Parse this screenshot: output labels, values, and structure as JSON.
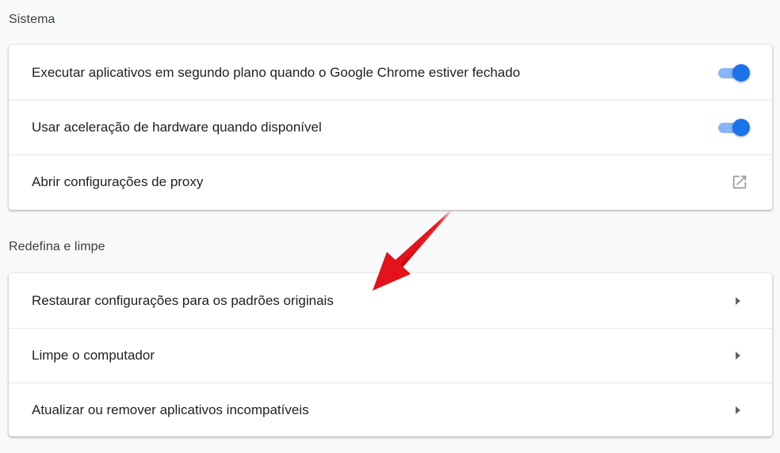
{
  "sections": {
    "sistema": {
      "title": "Sistema",
      "rows": [
        {
          "label": "Executar aplicativos em segundo plano quando o Google Chrome estiver fechado",
          "control": "toggle",
          "enabled": true
        },
        {
          "label": "Usar aceleração de hardware quando disponível",
          "control": "toggle",
          "enabled": true
        },
        {
          "label": "Abrir configurações de proxy",
          "control": "external-link-icon"
        }
      ]
    },
    "redefina": {
      "title": "Redefina e limpe",
      "rows": [
        {
          "label": "Restaurar configurações para os padrões originais",
          "control": "chevron-right-icon"
        },
        {
          "label": "Limpe o computador",
          "control": "chevron-right-icon"
        },
        {
          "label": "Atualizar ou remover aplicativos incompatíveis",
          "control": "chevron-right-icon"
        }
      ]
    }
  },
  "colors": {
    "toggle_on_knob": "#1a73e8",
    "toggle_on_track": "#8ab4f8",
    "annotation_arrow": "#e3121b"
  }
}
